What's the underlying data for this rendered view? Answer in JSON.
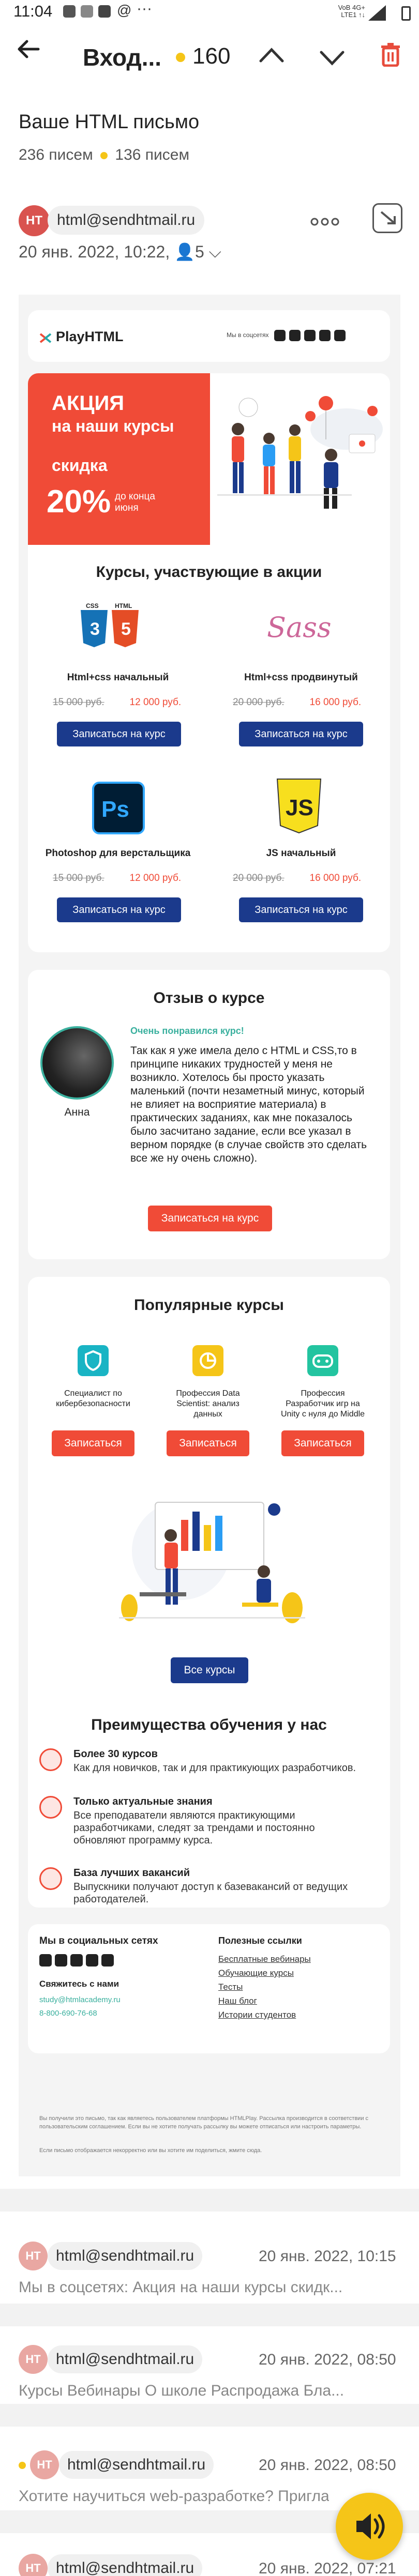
{
  "status_bar": {
    "time": "11:04",
    "carrier": "VoB 4G+",
    "network": "LTE1 ↑↓"
  },
  "toolbar": {
    "title": "Вход...",
    "unread_count": "160"
  },
  "message": {
    "subject": "Ваше HTML письмо",
    "total_count": "236 писем",
    "unread_count": "136 писем",
    "sender_initials": "HT",
    "sender": "html@sendhtmail.ru",
    "datetime": "20 янв. 2022, 10:22,",
    "recipients_count": "5"
  },
  "email": {
    "logo": "PlayHTML",
    "social_label": "Мы в соцсетях",
    "promo": {
      "title_line1": "АКЦИЯ",
      "title_line2": "на наши курсы",
      "discount_label": "скидка",
      "discount_value": "20%",
      "until_line1": "до конца",
      "until_line2": "июня"
    },
    "courses_title": "Курсы, участвующие в акции",
    "courses": [
      {
        "name": "Html+css начальный",
        "old_price": "15 000 руб.",
        "new_price": "12 000 руб.",
        "button": "Записаться на курс",
        "icon": "html-css-icon"
      },
      {
        "name": "Html+css продвинутый",
        "old_price": "20 000 руб.",
        "new_price": "16 000 руб.",
        "button": "Записаться на курс",
        "icon": "sass-icon"
      },
      {
        "name": "Photoshop для верстальщика",
        "old_price": "15 000 руб.",
        "new_price": "12 000 руб.",
        "button": "Записаться на курс",
        "icon": "photoshop-icon"
      },
      {
        "name": "JS начальный",
        "old_price": "20 000 руб.",
        "new_price": "16 000 руб.",
        "button": "Записаться на курс",
        "icon": "js-icon"
      }
    ],
    "review": {
      "title": "Отзыв о курсе",
      "author": "Анна",
      "headline": "Очень понравился курс!",
      "text": "Так как я уже имела дело с HTML и CSS,то в принципе никаких трудностей у меня не возникло. Хотелось бы просто указать маленький (почти незаметный минус, который не влияет на восприятие материала) в практических заданиях, как мне показалось было засчитано задание, если все указал в верном порядке (в случае свойств это сделать все же ну очень сложно).",
      "button": "Записаться на курс"
    },
    "popular": {
      "title": "Популярные курсы",
      "items": [
        {
          "name": "Специалист по кибербезопасности",
          "button": "Записаться"
        },
        {
          "name": "Профессия Data Scientist: анализ данных",
          "button": "Записаться"
        },
        {
          "name": "Профессия Разработчик игр на Unity с нуля до Middle",
          "button": "Записаться"
        }
      ],
      "all_button": "Все курсы"
    },
    "benefits": {
      "title": "Преимущества обучения у нас",
      "items": [
        {
          "title": "Более 30 курсов",
          "text": "Как для новичков, так и для практикующих разработчиков."
        },
        {
          "title": "Только актуальные знания",
          "text": "Все преподаватели являются практикующими разработчиками, следят за трендами и постоянно обновляют программу курса."
        },
        {
          "title": "База лучших вакансий",
          "text": "Выпускники получают доступ к базевакансий от ведущих работодателей."
        }
      ]
    },
    "footer": {
      "social_title": "Мы в социальных сетях",
      "contact_title": "Свяжитесь с нами",
      "email": "study@htmlacademy.ru",
      "phone": "8-800-690-76-68",
      "links_title": "Полезные ссылки",
      "links": [
        "Бесплатные вебинары",
        "Обучающие курсы",
        "Тесты",
        "Наш блог",
        "Истории студентов"
      ],
      "fine_print_1": "Вы получили это письмо, так как являетесь пользователем платформы HTMLPlay. Рассылка производится в соответствии с пользовательским соглашением. Если вы не хотите получать рассылку вы можете отписаться или настроить параметры.",
      "fine_print_2": "Если письмо отображается некорректно или вы хотите им поделиться, жмите сюда."
    }
  },
  "thread": [
    {
      "sender": "html@sendhtmail.ru",
      "date": "20 янв. 2022, 10:15",
      "preview": "Мы в соцсетях: Акция на наши курсы скидк..."
    },
    {
      "sender": "html@sendhtmail.ru",
      "date": "20 янв. 2022, 08:50",
      "preview": "Курсы Вебинары О школе Распродажа Бла..."
    },
    {
      "sender": "html@sendhtmail.ru",
      "date": "20 янв. 2022, 08:50",
      "preview": "Хотите научиться web-разработке? Пригла..."
    },
    {
      "sender": "html@sendhtmail.ru",
      "date": "20 янв. 2022, 07:21",
      "preview": ""
    }
  ],
  "colors": {
    "accent_red": "#f04b37",
    "brand_blue": "#1b3a8c",
    "unread_yellow": "#f5c518",
    "avatar_red": "#d9534f"
  }
}
